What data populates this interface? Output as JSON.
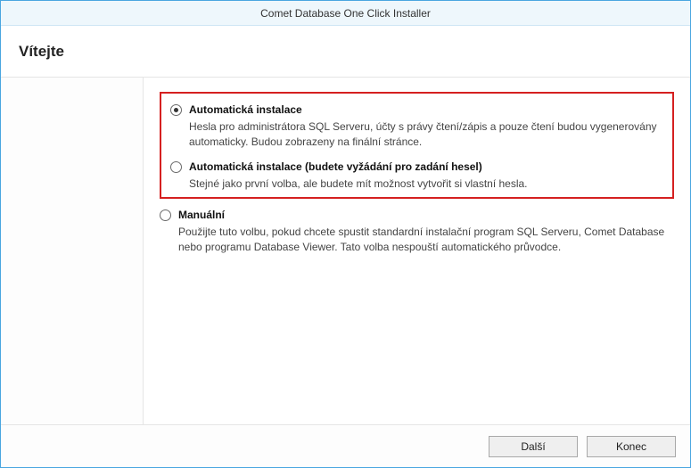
{
  "window": {
    "title": "Comet Database One Click Installer"
  },
  "header": {
    "title": "Vítejte"
  },
  "options": [
    {
      "title": "Automatická instalace",
      "desc": "Hesla pro administrátora SQL Serveru, účty s právy čtení/zápis a pouze čtení budou vygenerovány automaticky. Budou zobrazeny na finální stránce.",
      "checked": true,
      "highlighted": true
    },
    {
      "title": "Automatická instalace (budete vyžádání pro zadání hesel)",
      "desc": "Stejné jako první volba, ale budete mít možnost vytvořit si vlastní hesla.",
      "checked": false,
      "highlighted": true
    },
    {
      "title": "Manuální",
      "desc": "Použijte tuto volbu, pokud chcete spustit standardní instalační program SQL Serveru, Comet Database nebo programu Database Viewer. Tato volba nespouští automatického průvodce.",
      "checked": false,
      "highlighted": false
    }
  ],
  "footer": {
    "next": "Další",
    "close": "Konec"
  }
}
